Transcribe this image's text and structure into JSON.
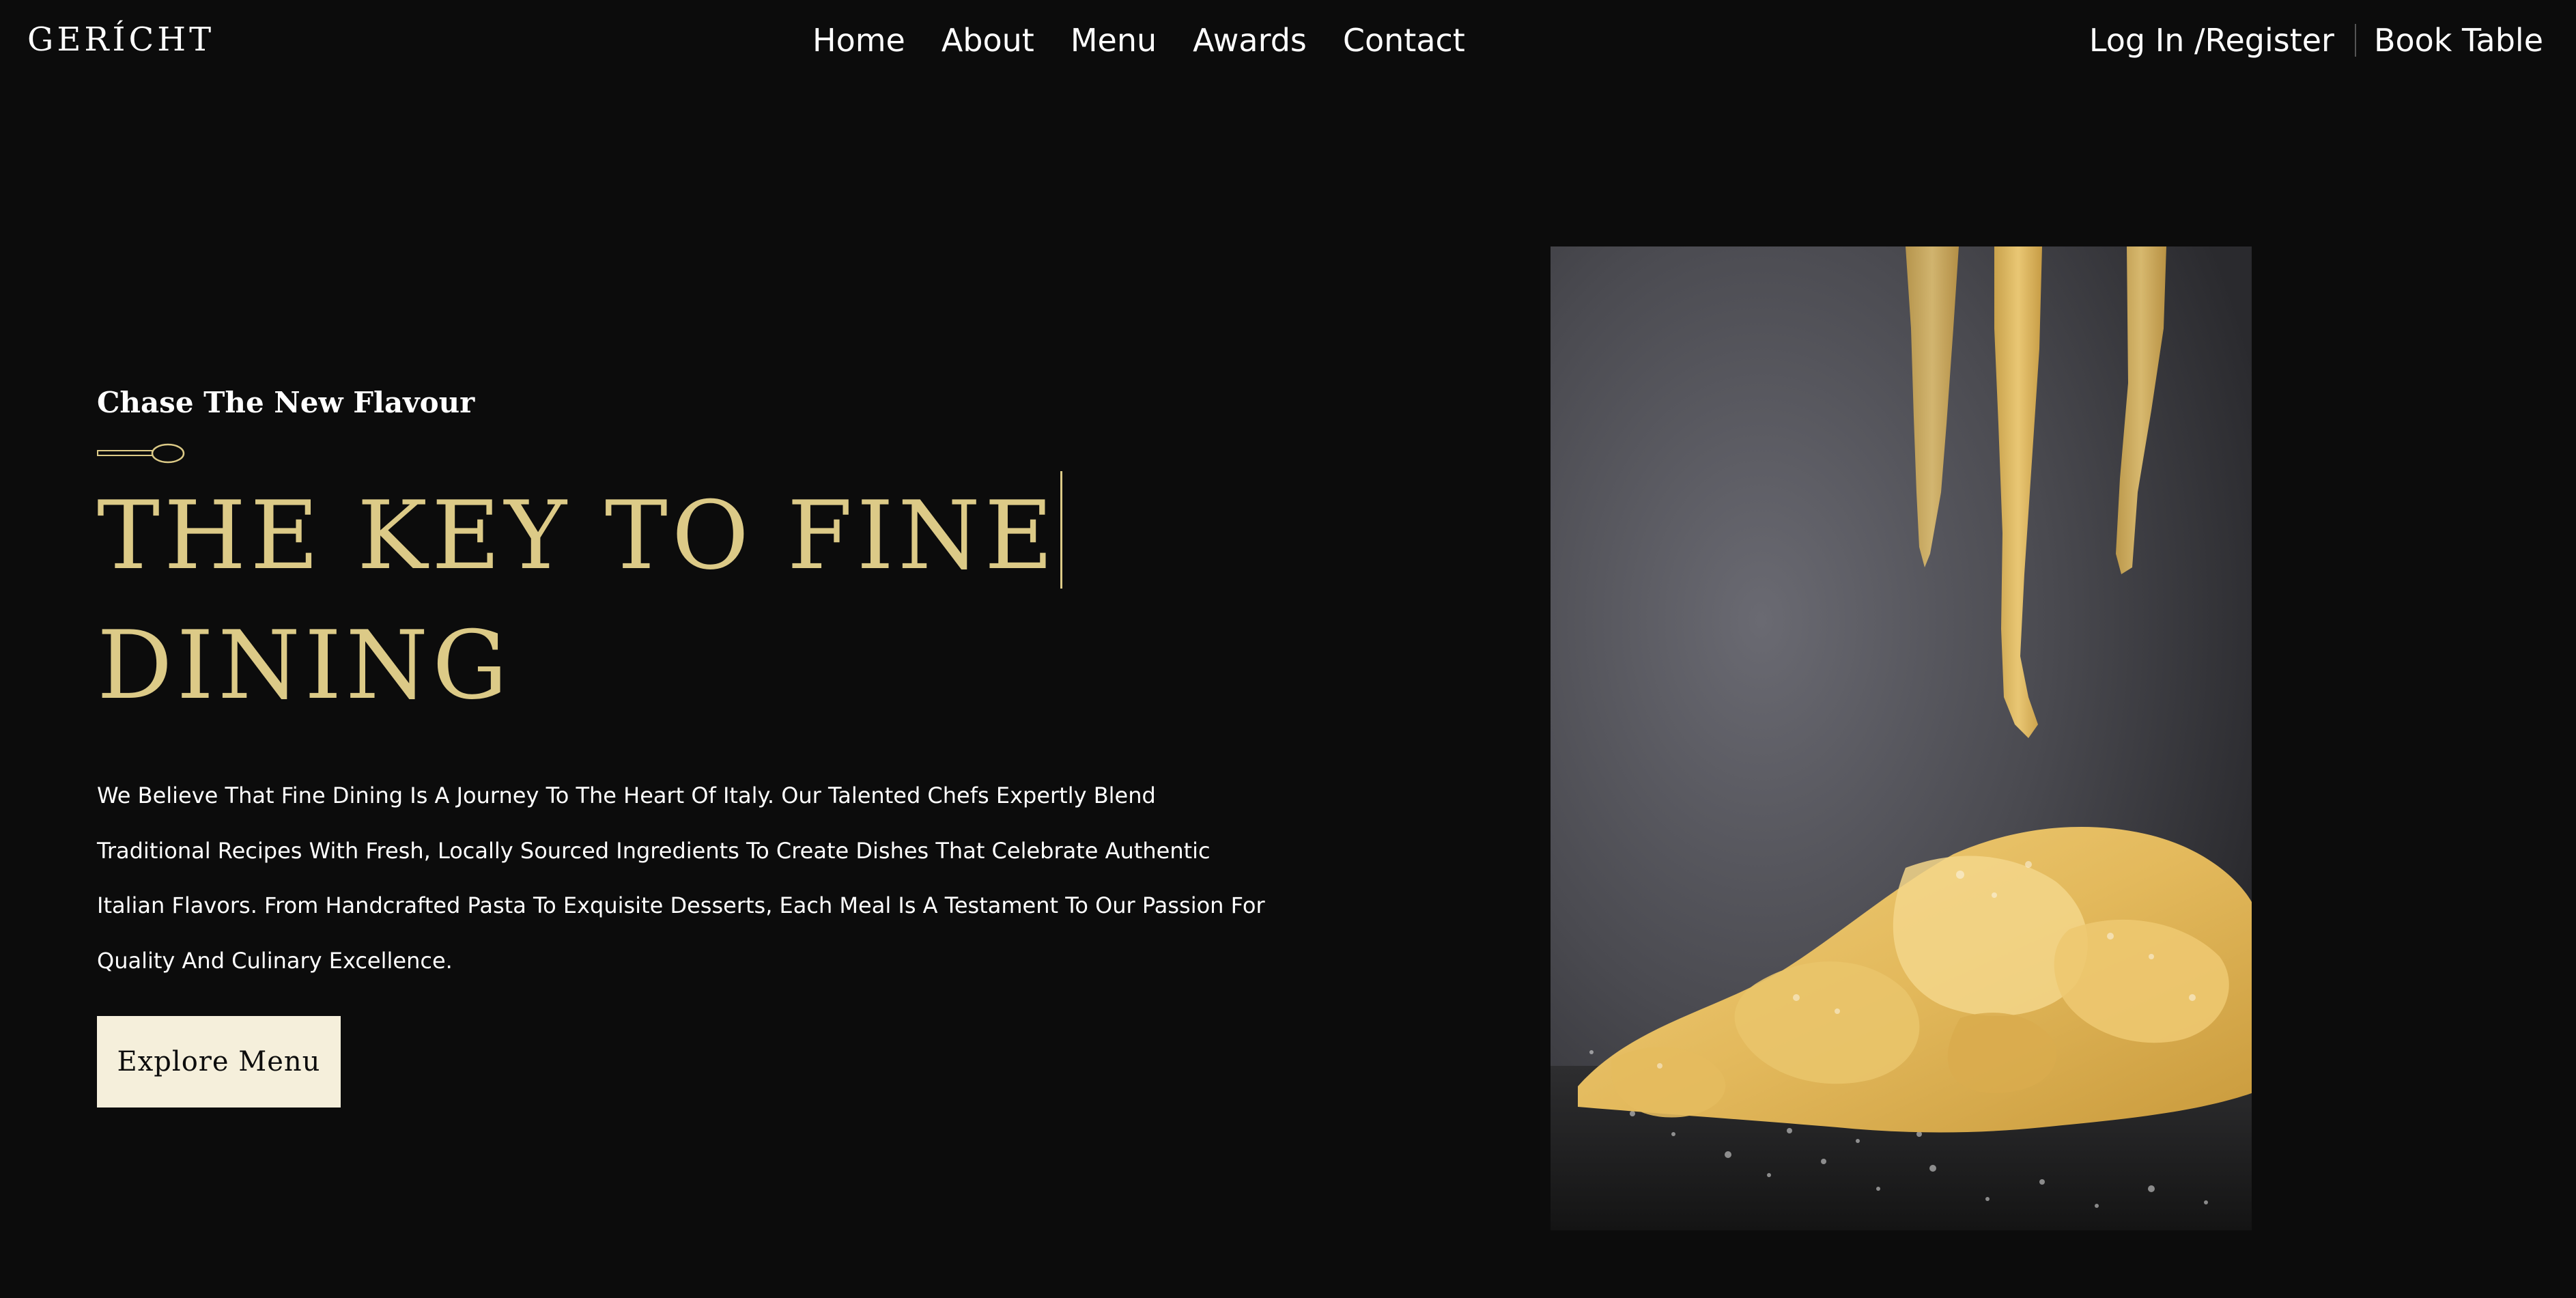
{
  "brand": {
    "logo_text": "GERÍCHT",
    "accent_color": "#dcca87",
    "background_color": "#0c0c0c",
    "button_color": "#f5efdb"
  },
  "nav": {
    "items": [
      {
        "label": "Home"
      },
      {
        "label": "About"
      },
      {
        "label": "Menu"
      },
      {
        "label": "Awards"
      },
      {
        "label": "Contact"
      }
    ],
    "login_label": "Log In /Register",
    "book_label": "Book Table"
  },
  "hero": {
    "tagline": "Chase The New Flavour",
    "tagline_icon": "spoon-icon",
    "headline_line1": "THE KEY TO FINE",
    "headline_line2": "DINING",
    "description": "We Believe That Fine Dining Is A Journey To The Heart Of Italy. Our Talented Chefs Expertly Blend Traditional Recipes With Fresh, Locally Sourced Ingredients To Create Dishes That Celebrate Authentic Italian Flavors. From Handcrafted Pasta To Exquisite Desserts, Each Meal Is A Testament To Our Passion For Quality And Culinary Excellence.",
    "cta_label": "Explore Menu"
  }
}
